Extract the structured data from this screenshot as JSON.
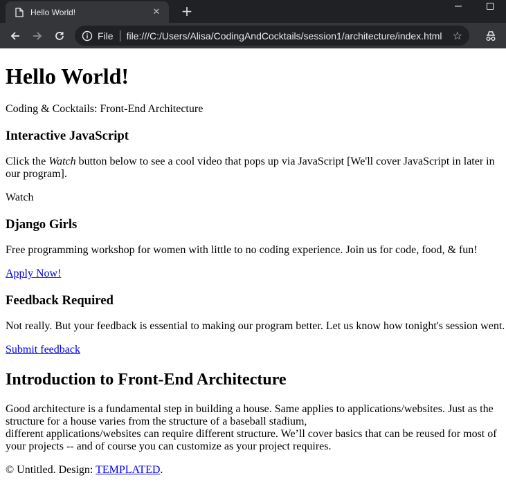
{
  "browser": {
    "tab_title": "Hello World!",
    "tab_close": "✕",
    "new_tab": "+",
    "scheme_label": "File",
    "url": "file:///C:/Users/Alisa/CodingAndCocktails/session1/architecture/index.html",
    "star": "☆"
  },
  "page": {
    "title": "Hello World!",
    "subtitle": "Coding & Cocktails: Front-End Architecture",
    "js_section": {
      "heading": "Interactive JavaScript",
      "text_before": "Click the ",
      "text_em": "Watch",
      "text_after": " button below to see a cool video that pops up via JavaScript [We'll cover JavaScript in later in our program].",
      "watch_label": "Watch"
    },
    "django_section": {
      "heading": "Django Girls",
      "text": "Free programming workshop for women with little to no coding experience. Join us for code, food, & fun!",
      "link": "Apply Now!"
    },
    "feedback_section": {
      "heading": "Feedback Required",
      "text": "Not really. But your feedback is essential to making our program better. Let us know how tonight's session went.",
      "link": "Submit feedback"
    },
    "intro_section": {
      "heading": "Introduction to Front-End Architecture",
      "text_line1": "Good architecture is a fundamental step in building a house. Same applies to applications/websites. Just as the structure for a house varies from the structure of a baseball stadium,",
      "text_line2": "different applications/websites can require different structure. We’ll cover basics that can be reused for most of your projects -- and of course you can customize as your project requires."
    },
    "footer": {
      "text": "© Untitled. Design: ",
      "link": "TEMPLATED",
      "period": "."
    }
  },
  "colors": {
    "chrome_dark": "#202124",
    "chrome_tab": "#35363a",
    "link": "#0000ee"
  }
}
